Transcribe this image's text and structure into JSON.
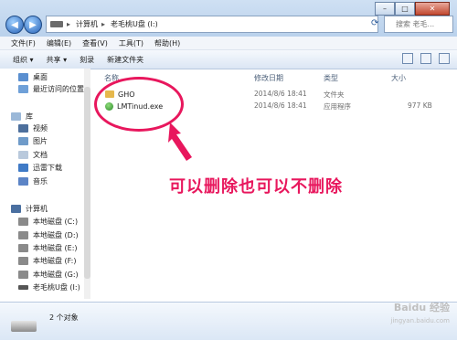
{
  "address": {
    "segments": [
      "计算机",
      "老毛桃U盘 (I:)"
    ]
  },
  "search": {
    "placeholder": "搜索 老毛..."
  },
  "menubar": [
    "文件(F)",
    "编辑(E)",
    "查看(V)",
    "工具(T)",
    "帮助(H)"
  ],
  "toolbar": [
    "组织 ▾",
    "共享 ▾",
    "刻录",
    "新建文件夹"
  ],
  "sidebar": {
    "items": [
      {
        "label": "桌面",
        "icon": "desktop-icon",
        "color": "#5a8fd0"
      },
      {
        "label": "最近访问的位置",
        "icon": "recent-icon",
        "color": "#6fa0d8"
      },
      {
        "label": "库",
        "icon": "library-icon",
        "color": "#9bb8d8"
      },
      {
        "label": "视频",
        "icon": "video-icon",
        "color": "#4d6f9c"
      },
      {
        "label": "图片",
        "icon": "picture-icon",
        "color": "#6f9bc9"
      },
      {
        "label": "文档",
        "icon": "document-icon",
        "color": "#b9c9dc"
      },
      {
        "label": "迅雷下载",
        "icon": "thunder-icon",
        "color": "#3f7ac6"
      },
      {
        "label": "音乐",
        "icon": "music-icon",
        "color": "#5c84c6"
      },
      {
        "label": "计算机",
        "icon": "computer-icon",
        "color": "#4a6fa0"
      },
      {
        "label": "本地磁盘 (C:)",
        "icon": "disk-icon",
        "color": "#8a8a8a"
      },
      {
        "label": "本地磁盘 (D:)",
        "icon": "disk-icon",
        "color": "#8a8a8a"
      },
      {
        "label": "本地磁盘 (E:)",
        "icon": "disk-icon",
        "color": "#8a8a8a"
      },
      {
        "label": "本地磁盘 (F:)",
        "icon": "disk-icon",
        "color": "#8a8a8a"
      },
      {
        "label": "本地磁盘 (G:)",
        "icon": "disk-icon",
        "color": "#8a8a8a"
      },
      {
        "label": "老毛桃U盘 (I:)",
        "icon": "usb-drive-icon",
        "color": "#555555"
      }
    ]
  },
  "columns": {
    "name": "名称",
    "date": "修改日期",
    "type": "类型",
    "size": "大小"
  },
  "files": [
    {
      "name": "GHO",
      "date": "2014/8/6 18:41",
      "type": "文件夹",
      "size": ""
    },
    {
      "name": "LMTinud.exe",
      "date": "2014/8/6 18:41",
      "type": "应用程序",
      "size": "977 KB"
    }
  ],
  "annotation": {
    "text": "可以删除也可以不删除",
    "color": "#e8175d"
  },
  "status": {
    "count": "2 个对象"
  },
  "watermark": {
    "brand": "Baidu 经验",
    "url": "jingyan.baidu.com"
  }
}
